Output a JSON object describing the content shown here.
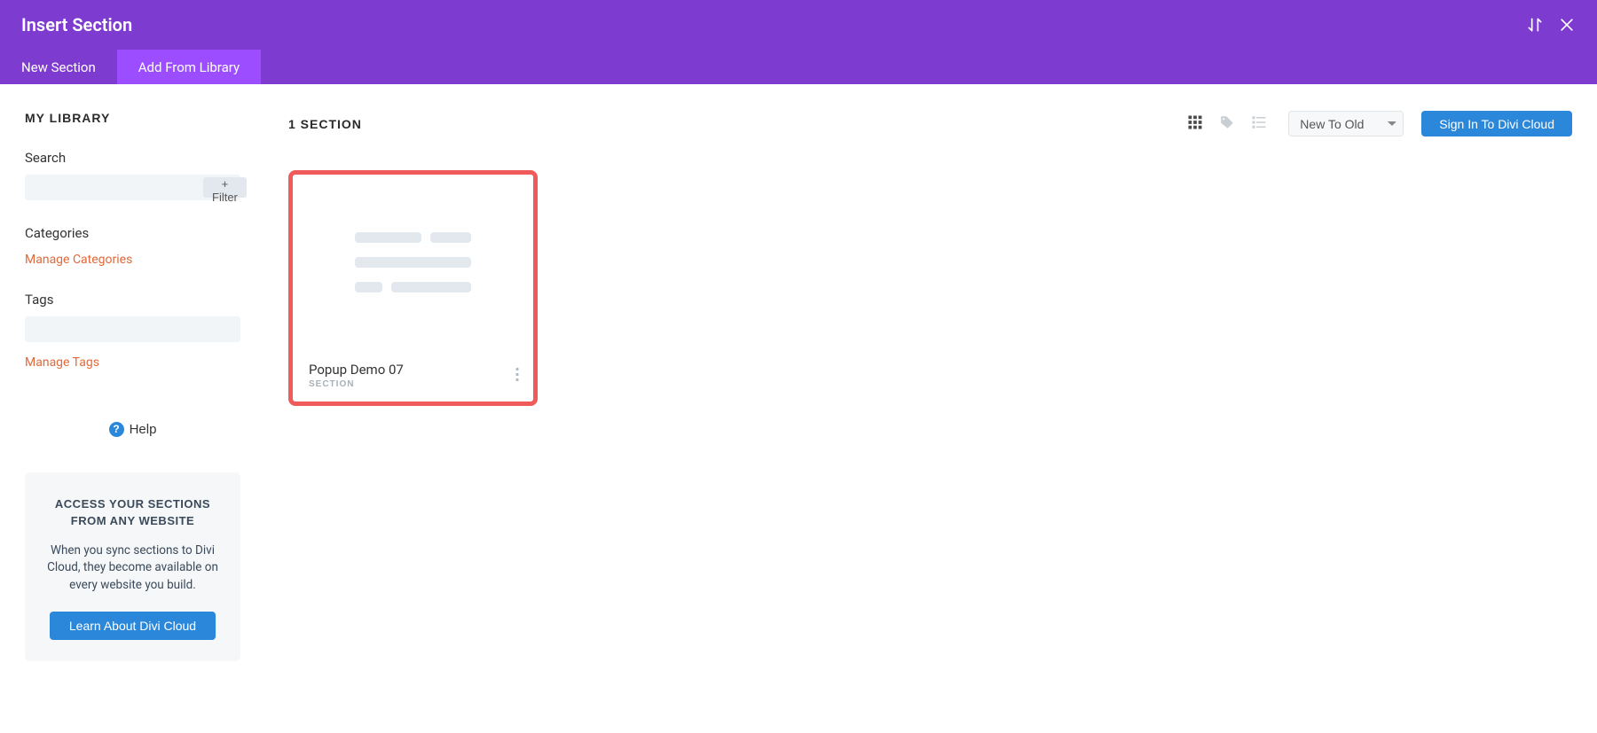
{
  "topbar": {
    "title": "Insert Section"
  },
  "tabs": {
    "new_section": "New Section",
    "add_from_library": "Add From Library"
  },
  "sidebar": {
    "title": "My Library",
    "search_label": "Search",
    "filter_button": "+ Filter",
    "categories_label": "Categories",
    "manage_categories": "Manage Categories",
    "tags_label": "Tags",
    "manage_tags": "Manage Tags",
    "help_label": "Help",
    "promo": {
      "title": "Access Your Sections From Any Website",
      "text": "When you sync sections to Divi Cloud, they become available on every website you build.",
      "button": "Learn About Divi Cloud"
    }
  },
  "main": {
    "count_label": "1 Section",
    "sort_value": "New To Old",
    "signin_button": "Sign In To Divi Cloud",
    "items": [
      {
        "name": "Popup Demo 07",
        "type": "Section"
      }
    ]
  }
}
